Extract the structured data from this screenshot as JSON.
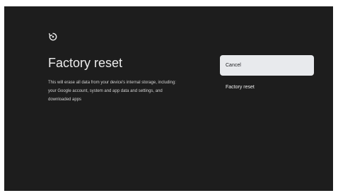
{
  "header": {
    "icon": "reset-icon",
    "title": "Factory reset",
    "description": "This will erase all data from your device's internal storage, including: your Google account, system and app data and settings, and downloaded apps"
  },
  "options": [
    {
      "label": "Cancel",
      "focused": true
    },
    {
      "label": "Factory reset",
      "focused": false
    }
  ],
  "colors": {
    "background": "#1d1d1d",
    "focus_background": "#e8eaed",
    "text_primary": "#ececec"
  }
}
